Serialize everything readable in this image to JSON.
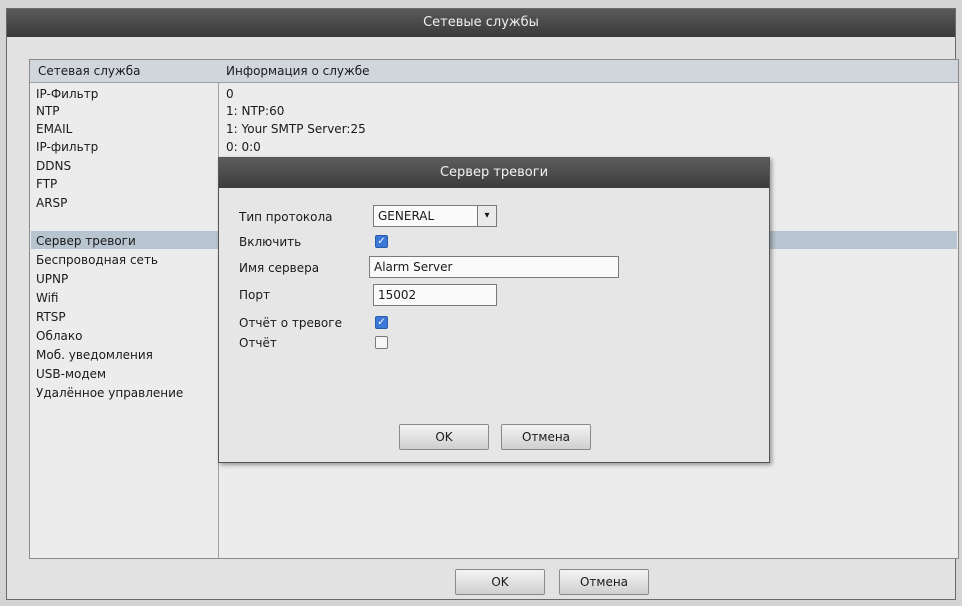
{
  "window": {
    "title": "Сетевые службы"
  },
  "list": {
    "header_name": "Сетевая служба",
    "header_info": "Информация о службе",
    "items": [
      "IP-Фильтр",
      "NTP",
      "EMAIL",
      "IP-фильтр",
      "DDNS",
      "FTP",
      "ARSP",
      "Сервер тревоги",
      "Беспроводная сеть",
      "UPNP",
      "Wifi",
      "RTSP",
      "Облако",
      "Моб. уведомления",
      "USB-модем",
      "Удалённое управление"
    ],
    "info": [
      "0",
      "1: NTP:60",
      "1: Your SMTP Server:25",
      "0: 0:0"
    ]
  },
  "buttons": {
    "ok": "OK",
    "cancel": "Отмена"
  },
  "dialog": {
    "title": "Сервер тревоги",
    "protocol_label": "Тип протокола",
    "protocol_value": "GENERAL",
    "enable_label": "Включить",
    "server_label": "Имя сервера",
    "server_value": "Alarm Server",
    "port_label": "Порт",
    "port_value": "15002",
    "alarm_report_label": "Отчёт о тревоге",
    "log_label": "Отчёт",
    "ok": "OK",
    "cancel": "Отмена"
  }
}
